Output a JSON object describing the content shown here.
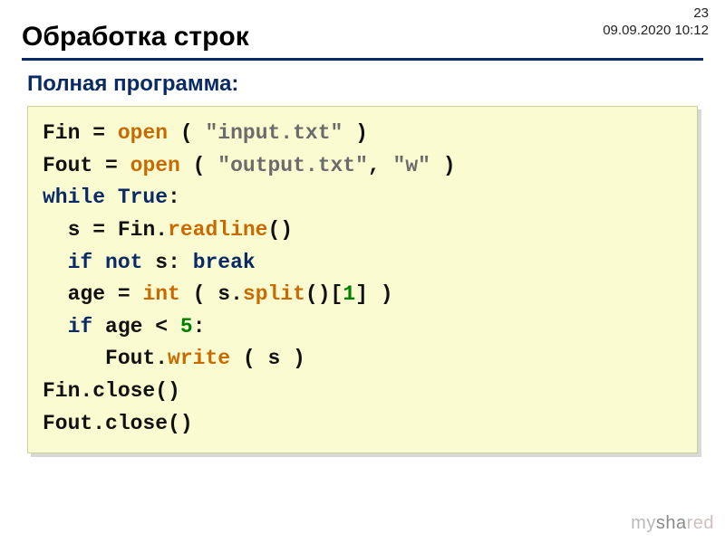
{
  "meta": {
    "page_number": "23",
    "timestamp": "09.09.2020 10:12"
  },
  "title": "Обработка строк",
  "subtitle": "Полная программа:",
  "code": {
    "l1": {
      "a": "Fin",
      "eq": " = ",
      "fn": "open",
      "b": " ( ",
      "s": "\"input.txt\"",
      "c": " )"
    },
    "l2": {
      "a": "Fout",
      "eq": " = ",
      "fn": "open",
      "b": " ( ",
      "s": "\"output.txt\"",
      "c": ", ",
      "s2": "\"w\"",
      "d": " )"
    },
    "l3": {
      "kw": "while",
      "sp": " ",
      "cst": "True",
      "c": ":"
    },
    "l4": {
      "ind": "  ",
      "a": "s",
      "eq": " = ",
      "b": "Fin.",
      "fn": "readline",
      "c": "()"
    },
    "l5": {
      "ind": "  ",
      "kw1": "if",
      "sp1": " ",
      "kw2": "not",
      "sp2": " ",
      "a": "s: ",
      "kw3": "break"
    },
    "l6": {
      "ind": "  ",
      "a": "age",
      "eq": " = ",
      "fn1": "int",
      "b": " ( s.",
      "fn2": "split",
      "c": "()[",
      "n": "1",
      "d": "] )"
    },
    "l7": {
      "ind": "  ",
      "kw": "if",
      "sp": " ",
      "a": "age",
      "op": " < ",
      "n": "5",
      "c": ":"
    },
    "l8": {
      "ind": "     ",
      "a": "Fout.",
      "fn": "write",
      "b": " ( s )"
    },
    "l9": {
      "a": "Fin.close()"
    },
    "l10": {
      "a": "Fout.close()"
    }
  },
  "watermark": {
    "a": "my",
    "b": "sha",
    "c": "red"
  }
}
